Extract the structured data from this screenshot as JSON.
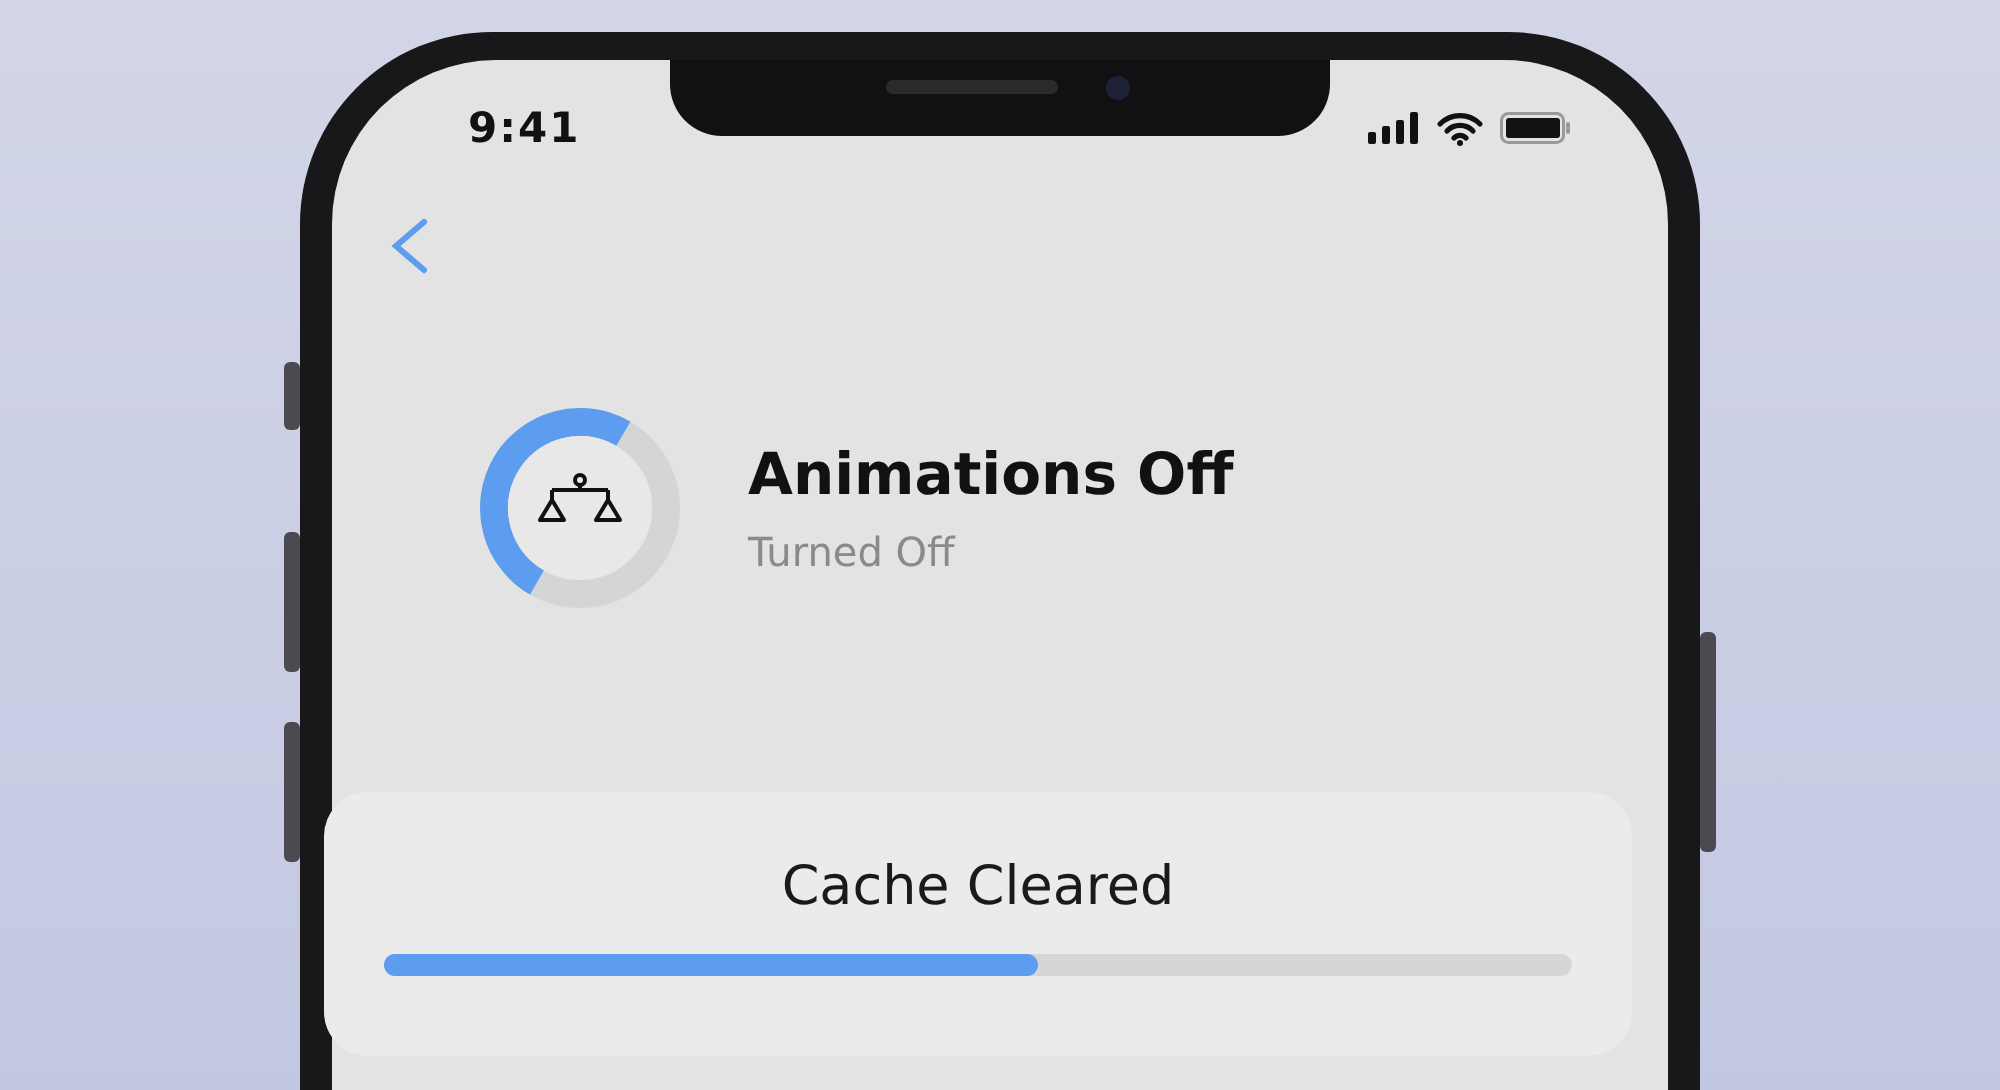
{
  "status_bar": {
    "time": "9:41"
  },
  "header": {
    "title": "Animations Off",
    "subtitle": "Turned Off",
    "ring": {
      "level": 0.5
    }
  },
  "card": {
    "title": "Cache Cleared",
    "progress": {
      "level": 0.55
    }
  }
}
